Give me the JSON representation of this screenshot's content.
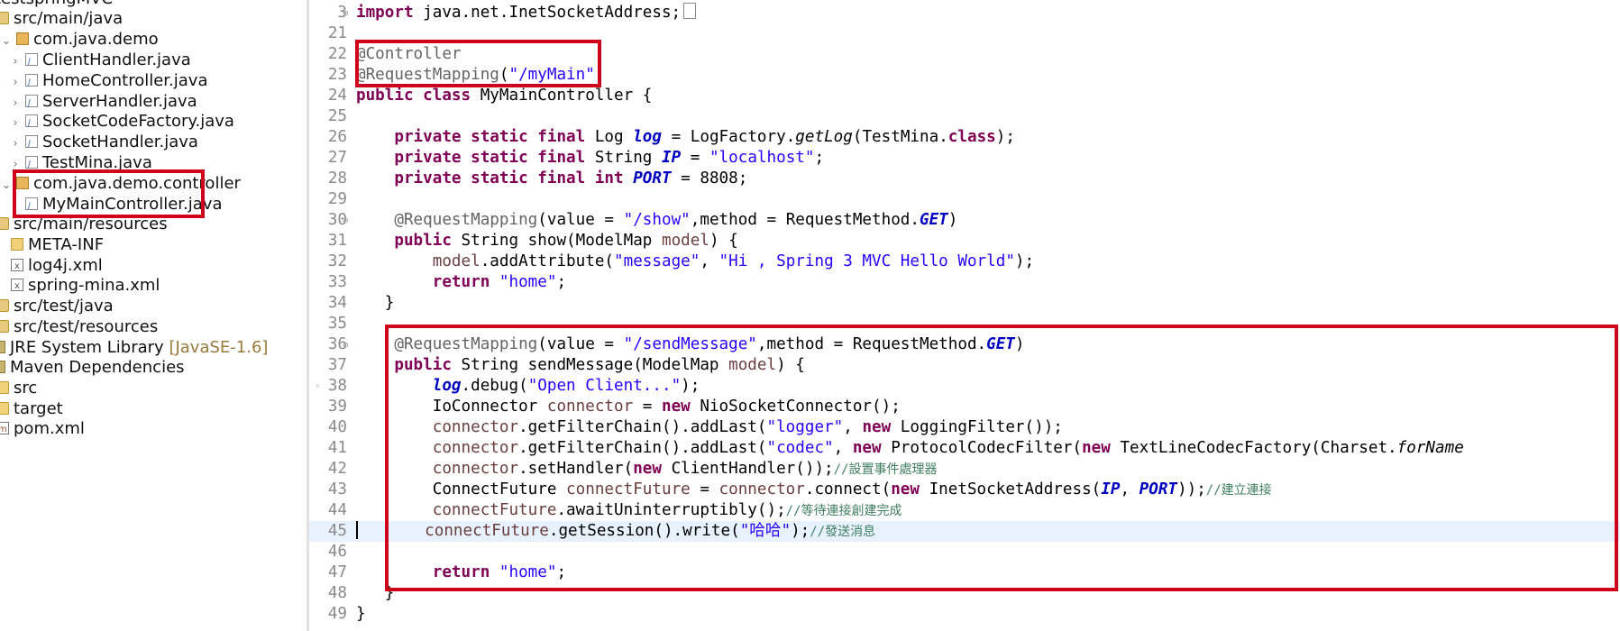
{
  "explorer": {
    "items": [
      {
        "label": "testspringMVC"
      },
      {
        "label": "src/main/java"
      },
      {
        "label": "com.java.demo"
      },
      {
        "label": "ClientHandler.java"
      },
      {
        "label": "HomeController.java"
      },
      {
        "label": "ServerHandler.java"
      },
      {
        "label": "SocketCodeFactory.java"
      },
      {
        "label": "SocketHandler.java"
      },
      {
        "label": "TestMina.java"
      },
      {
        "label": "com.java.demo.controller"
      },
      {
        "label": "MyMainController.java"
      },
      {
        "label": "src/main/resources"
      },
      {
        "label": "META-INF"
      },
      {
        "label": "log4j.xml"
      },
      {
        "label": "spring-mina.xml"
      },
      {
        "label": "src/test/java"
      },
      {
        "label": "src/test/resources"
      },
      {
        "label": "JRE System Library",
        "suffix": "[JavaSE-1.6]"
      },
      {
        "label": "Maven Dependencies"
      },
      {
        "label": "src"
      },
      {
        "label": "target"
      },
      {
        "label": "pom.xml"
      }
    ]
  },
  "editor": {
    "line_numbers": [
      "3",
      "21",
      "22",
      "23",
      "24",
      "25",
      "26",
      "27",
      "28",
      "29",
      "30",
      "31",
      "32",
      "33",
      "34",
      "35",
      "36",
      "37",
      "38",
      "39",
      "40",
      "41",
      "42",
      "43",
      "44",
      "45",
      "46",
      "47",
      "48",
      "49"
    ],
    "tokens": {
      "import": "import",
      "import_rest": " java.net.InetSocketAddress;",
      "controller": "@Controller",
      "request_mapping": "@RequestMapping",
      "my_main_str": "\"/myMain\"",
      "public": "public",
      "class": "class",
      "class_name": " MyMainController {",
      "private": "private",
      "static": "static",
      "final": "final",
      "int": "int",
      "new": "new",
      "return": "return",
      "class_kw": "class",
      "log_type": " Log ",
      "log_field": "log",
      "log_factory": " = LogFactory.",
      "get_log": "getLog",
      "test_mina": "(TestMina.",
      "close_semi": ");",
      "string_type": " String ",
      "ip_field": "IP",
      "localhost_str": "\"localhost\"",
      "port_field": "PORT",
      "port_value": " = 8808;",
      "value_eq": "(value = ",
      "show_str": "\"/show\"",
      "method_eq": ",method = RequestMethod.",
      "get": "GET",
      "show_sig": " String show(ModelMap ",
      "model": "model",
      "sig_close": ") {",
      "add_attr": ".addAttribute(",
      "message_str": "\"message\"",
      "comma": ", ",
      "hello_str": "\"Hi , Spring 3 MVC Hello World\"",
      "home_str": "\"home\"",
      "semi": ";",
      "brace": "}",
      "send_str": "\"/sendMessage\"",
      "send_sig": " String sendMessage(ModelMap ",
      "debug": ".debug(",
      "open_client_str": "\"Open Client...\"",
      "io_connector": "IoConnector ",
      "connector": "connector",
      "nio": " NioSocketConnector();",
      "filter_chain": ".getFilterChain().addLast(",
      "logger_str": "\"logger\"",
      "logging_filter": " LoggingFilter());",
      "codec_str": "\"codec\"",
      "protocol_filter": " ProtocolCodecFilter(",
      "textline": " TextLineCodecFactory(Charset.",
      "for_name": "forName",
      "set_handler": ".setHandler(",
      "client_handler": " ClientHandler());",
      "cmt_handler": "//設置事件處理器",
      "connect_future_type": "ConnectFuture ",
      "connect_future": "connectFuture",
      "connect_call": ".connect(",
      "inet": " InetSocketAddress(",
      "close2": "));",
      "cmt_connect": "//建立連接",
      "await": ".awaitUninterruptibly();",
      "cmt_await": "//等待連接創建完成",
      "session": ".getSession().write(",
      "haha_str": "\"哈哈\"",
      "cmt_send": "//發送消息",
      "eq_sp": " = ",
      "sp": " ",
      "paren_open": "(",
      "paren_close": ")"
    }
  },
  "colors": {
    "keyword": "#7f0055",
    "string": "#2a00ff",
    "annotation": "#646464",
    "field": "#0000c0",
    "comment": "#3f7f5f",
    "highlight_box": "#d0021b"
  }
}
